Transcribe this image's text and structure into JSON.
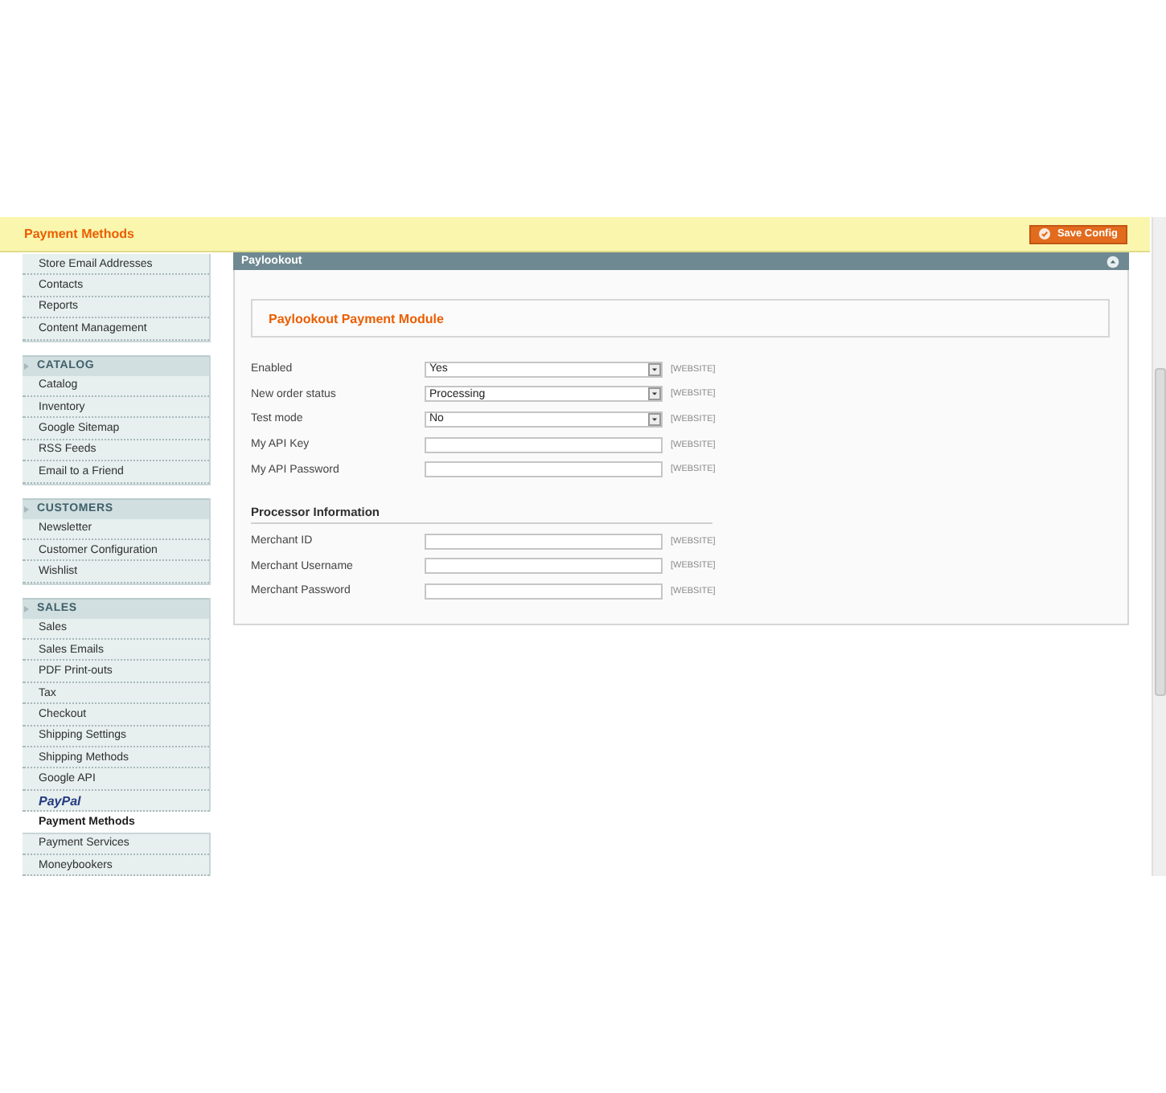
{
  "header": {
    "title": "Payment Methods",
    "save_button": "Save Config"
  },
  "sidebar": {
    "groups": [
      {
        "items": [
          {
            "label": "Store Email Addresses",
            "kind": "link",
            "selected": false
          },
          {
            "label": "Contacts",
            "kind": "link",
            "selected": false
          },
          {
            "label": "Reports",
            "kind": "link",
            "selected": false
          },
          {
            "label": "Content Management",
            "kind": "link",
            "selected": false
          }
        ]
      },
      {
        "title": "CATALOG",
        "items": [
          {
            "label": "Catalog",
            "kind": "link",
            "selected": false
          },
          {
            "label": "Inventory",
            "kind": "link",
            "selected": false
          },
          {
            "label": "Google Sitemap",
            "kind": "link",
            "selected": false
          },
          {
            "label": "RSS Feeds",
            "kind": "link",
            "selected": false
          },
          {
            "label": "Email to a Friend",
            "kind": "link",
            "selected": false
          }
        ]
      },
      {
        "title": "CUSTOMERS",
        "items": [
          {
            "label": "Newsletter",
            "kind": "link",
            "selected": false
          },
          {
            "label": "Customer Configuration",
            "kind": "link",
            "selected": false
          },
          {
            "label": "Wishlist",
            "kind": "link",
            "selected": false
          }
        ]
      },
      {
        "title": "SALES",
        "items": [
          {
            "label": "Sales",
            "kind": "link",
            "selected": false
          },
          {
            "label": "Sales Emails",
            "kind": "link",
            "selected": false
          },
          {
            "label": "PDF Print-outs",
            "kind": "link",
            "selected": false
          },
          {
            "label": "Tax",
            "kind": "link",
            "selected": false
          },
          {
            "label": "Checkout",
            "kind": "link",
            "selected": false
          },
          {
            "label": "Shipping Settings",
            "kind": "link",
            "selected": false
          },
          {
            "label": "Shipping Methods",
            "kind": "link",
            "selected": false
          },
          {
            "label": "Google API",
            "kind": "link",
            "selected": false
          },
          {
            "label": "PayPal",
            "kind": "logo",
            "selected": false
          },
          {
            "label": "Payment Methods",
            "kind": "link",
            "selected": true
          },
          {
            "label": "Payment Services",
            "kind": "link",
            "selected": false
          },
          {
            "label": "Moneybookers",
            "kind": "link",
            "selected": false
          }
        ]
      }
    ]
  },
  "section": {
    "title": "Paylookout",
    "expanded": true,
    "module_title": "Paylookout Payment Module",
    "groups": [
      {
        "fields": [
          {
            "label": "Enabled",
            "kind": "select",
            "value": "Yes",
            "scope": "[WEBSITE]"
          },
          {
            "label": "New order status",
            "kind": "select",
            "value": "Processing",
            "scope": "[WEBSITE]"
          },
          {
            "label": "Test mode",
            "kind": "select",
            "value": "No",
            "scope": "[WEBSITE]"
          },
          {
            "label": "My API Key",
            "kind": "text",
            "scope": "[WEBSITE]"
          },
          {
            "label": "My API Password",
            "kind": "text",
            "scope": "[WEBSITE]"
          }
        ]
      },
      {
        "heading": "Processor Information",
        "fields": [
          {
            "label": "Merchant ID",
            "kind": "text",
            "scope": "[WEBSITE]"
          },
          {
            "label": "Merchant Username",
            "kind": "text",
            "scope": "[WEBSITE]"
          },
          {
            "label": "Merchant Password",
            "kind": "text",
            "scope": "[WEBSITE]"
          }
        ]
      }
    ]
  }
}
